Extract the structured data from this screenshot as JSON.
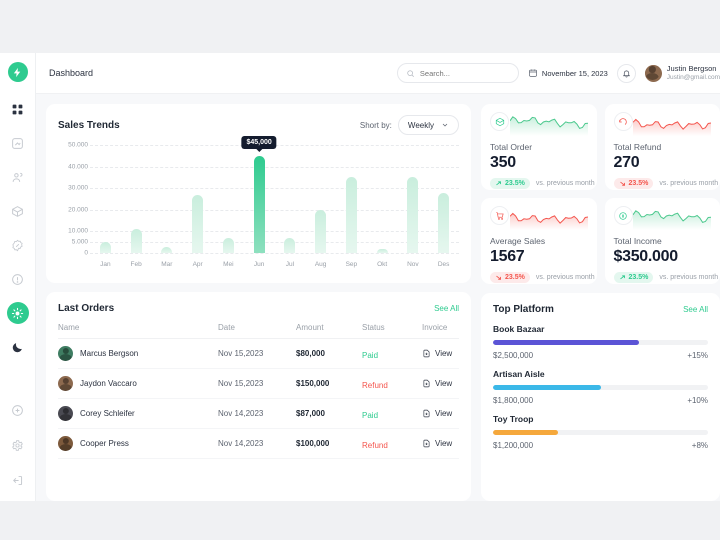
{
  "sidebar": {
    "logo_icon": "bolt-icon",
    "items": [
      {
        "name": "dashboard",
        "icon": "grid-icon",
        "active_style": "dark"
      },
      {
        "name": "analytics",
        "icon": "chart-arrow-icon",
        "active_style": "muted"
      },
      {
        "name": "customers",
        "icon": "users-icon",
        "active_style": "muted"
      },
      {
        "name": "products",
        "icon": "box-icon",
        "active_style": "muted"
      },
      {
        "name": "discounts",
        "icon": "badge-icon",
        "active_style": "muted"
      },
      {
        "name": "reports",
        "icon": "info-icon",
        "active_style": "muted"
      },
      {
        "name": "settings-active",
        "icon": "sun-icon",
        "active_style": "active"
      },
      {
        "name": "theme-toggle",
        "icon": "moon-icon",
        "active_style": "moon"
      }
    ],
    "bottom_items": [
      {
        "name": "add",
        "icon": "plus-circle-icon"
      },
      {
        "name": "settings",
        "icon": "gear-icon"
      },
      {
        "name": "logout",
        "icon": "logout-icon"
      }
    ]
  },
  "topbar": {
    "breadcrumb": "Dashboard",
    "search": {
      "placeholder": "Search...",
      "value": "",
      "icon": "search-icon"
    },
    "date": "November 15, 2023",
    "date_icon": "calendar-icon",
    "bell_icon": "bell-icon",
    "profile": {
      "name": "Justin Bergson",
      "email": "Justin@gmail.com",
      "avatar": "user-avatar"
    }
  },
  "sales": {
    "title": "Sales Trends",
    "sort_label": "Short by:",
    "sort_value": "Weekly",
    "chevron_icon": "chevron-down-icon",
    "tooltip": "$45,000"
  },
  "chart_data": {
    "type": "bar",
    "title": "Sales Trends",
    "xlabel": "",
    "ylabel": "",
    "categories": [
      "Jan",
      "Feb",
      "Mar",
      "Apr",
      "Mei",
      "Jun",
      "Jul",
      "Aug",
      "Sep",
      "Okt",
      "Nov",
      "Des"
    ],
    "values": [
      5000,
      11000,
      3000,
      27000,
      7000,
      45000,
      7000,
      20000,
      35000,
      2000,
      35000,
      28000
    ],
    "highlight_index": 5,
    "highlight_label": "$45,000",
    "ylim": [
      0,
      50000
    ],
    "yticks": [
      0,
      5000,
      10000,
      20000,
      30000,
      40000,
      50000
    ],
    "ytick_labels": [
      "0",
      "5.000",
      "10.000",
      "20.000",
      "30.000",
      "40.000",
      "50.000"
    ],
    "grid": true,
    "legend": "none",
    "bar_color": "#d7f2e6",
    "highlight_color": "#2ecb8f"
  },
  "orders": {
    "title": "Last Orders",
    "see_all": "See All",
    "columns": [
      "Name",
      "Date",
      "Amount",
      "Status",
      "Invoice"
    ],
    "view_label": "View",
    "view_icon": "file-download-icon",
    "rows": [
      {
        "name": "Marcus Bergson",
        "date": "Nov 15,2023",
        "amount": "$80,000",
        "status": "Paid",
        "invoice": "View"
      },
      {
        "name": "Jaydon Vaccaro",
        "date": "Nov 15,2023",
        "amount": "$150,000",
        "status": "Refund",
        "invoice": "View"
      },
      {
        "name": "Corey Schleifer",
        "date": "Nov 14,2023",
        "amount": "$87,000",
        "status": "Paid",
        "invoice": "View"
      },
      {
        "name": "Cooper Press",
        "date": "Nov 14,2023",
        "amount": "$100,000",
        "status": "Refund",
        "invoice": "View"
      }
    ]
  },
  "stats": [
    {
      "label": "Total Order",
      "value": "350",
      "delta": "23.5%",
      "direction": "up",
      "note": "vs. previous month",
      "icon": "package-icon",
      "accent": "#2ecb8f"
    },
    {
      "label": "Total Refund",
      "value": "270",
      "delta": "23.5%",
      "direction": "down",
      "note": "vs. previous month",
      "icon": "refund-icon",
      "accent": "#f4564e"
    },
    {
      "label": "Average Sales",
      "value": "1567",
      "delta": "23.5%",
      "direction": "down",
      "note": "vs. previous month",
      "icon": "cart-icon",
      "accent": "#f4564e"
    },
    {
      "label": "Total Income",
      "value": "$350.000",
      "delta": "23.5%",
      "direction": "up",
      "note": "vs. previous month",
      "icon": "coin-icon",
      "accent": "#2ecb8f"
    }
  ],
  "platform": {
    "title": "Top Platform",
    "see_all": "See All",
    "items": [
      {
        "name": "Book Bazaar",
        "amount": "$2,500,000",
        "percent": "+15%",
        "fill": 68,
        "color": "#5b54d6"
      },
      {
        "name": "Artisan Aisle",
        "amount": "$1,800,000",
        "percent": "+10%",
        "fill": 50,
        "color": "#3bb8e8"
      },
      {
        "name": "Toy Troop",
        "amount": "$1,200,000",
        "percent": "+8%",
        "fill": 30,
        "color": "#f5a83c"
      }
    ]
  }
}
